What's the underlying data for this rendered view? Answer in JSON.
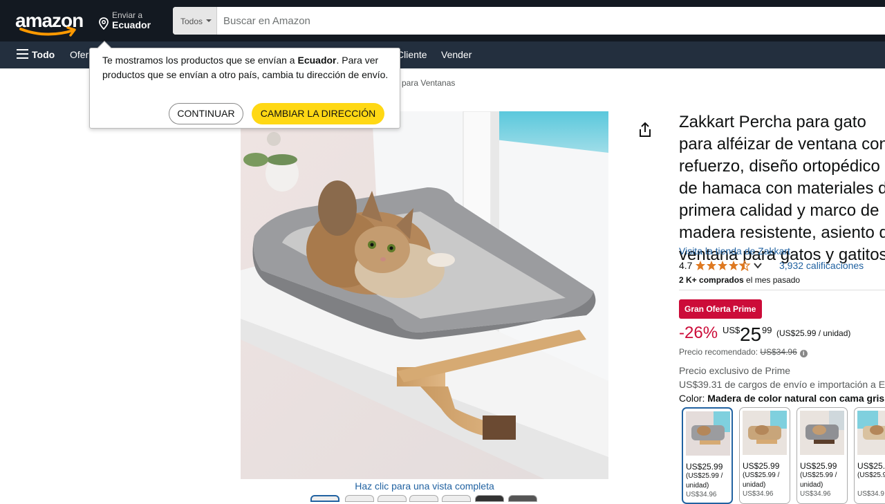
{
  "header": {
    "logo_text": "amazon",
    "deliver_line1": "Enviar a",
    "deliver_line2": "Ecuador",
    "search_category": "Todos",
    "search_placeholder": "Buscar en Amazon"
  },
  "nav": {
    "menu_label": "Todo",
    "items": [
      "Ofer",
      "Cliente",
      "Vender"
    ]
  },
  "breadcrumb_tail": "para Ventanas",
  "popover": {
    "msg_pre": "Te mostramos los productos que se envían a ",
    "msg_bold": "Ecuador",
    "msg_post": ". Para ver productos que se envían a otro país, cambia tu dirección de envío.",
    "continue_label": "CONTINUAR",
    "change_label": "CAMBIAR LA DIRECCIÓN"
  },
  "gallery": {
    "full_view_link": "Haz clic para una vista completa"
  },
  "product": {
    "title": "Zakkart Percha para gato para alféizar de ventana con refuerzo, diseño ortopédico de hamaca con materiales de primera calidad y marco de madera resistente, asiento de ventana para gatos y gatitos",
    "store_link": "Visita la tienda de Zakkart",
    "rating": "4.7",
    "ratings_count": "3,932 calificaciones",
    "bought_bold": "2 K+ comprados",
    "bought_rest": " el mes pasado",
    "deal_badge": "Gran Oferta Prime",
    "discount": "-26%",
    "price_currency": "US$",
    "price_whole": "25",
    "price_fraction": "99",
    "unit_price": "(US$25.99 / unidad)",
    "rrp_label": "Precio recomendado: ",
    "rrp_value": "US$34.96",
    "prime_exclusive": "Precio exclusivo de Prime",
    "shipping": "US$39.31 de cargos de envío e importación a E",
    "color_label": "Color: ",
    "color_value": "Madera de color natural con cama gris",
    "swatches": [
      {
        "price": "US$25.99",
        "unit": "(US$25.99 / unidad)",
        "old": "US$34.96"
      },
      {
        "price": "US$25.99",
        "unit": "(US$25.99 / unidad)",
        "old": "US$34.96"
      },
      {
        "price": "US$25.99",
        "unit": "(US$25.99 / unidad)",
        "old": "US$34.96"
      },
      {
        "price": "US$25.",
        "unit": "(US$25.9 /",
        "old": "US$34.9"
      }
    ]
  },
  "colors": {
    "header_bg": "#131921",
    "nav_bg": "#232f3e",
    "link": "#2162a1",
    "deal_red": "#cc0c39",
    "star": "#de7921",
    "yellow_button": "#ffd814"
  }
}
